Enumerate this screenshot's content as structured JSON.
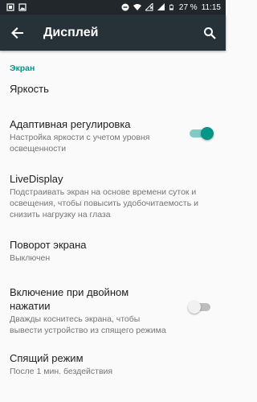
{
  "status_bar": {
    "battery": "27 %",
    "time": "11:15",
    "icons": [
      "notification-box-icon",
      "image-icon",
      "do-not-disturb-icon",
      "wifi-icon",
      "signal-no-sim-icon",
      "signal-icon",
      "battery-icon"
    ]
  },
  "toolbar": {
    "title": "Дисплей",
    "back_icon": "arrow-back-icon",
    "search_icon": "search-icon"
  },
  "colors": {
    "accent": "#009688",
    "toolbar": "#263238",
    "status_bar": "#21272b"
  },
  "section": {
    "header": "Экран"
  },
  "items": [
    {
      "title": "Яркость",
      "summary": ""
    },
    {
      "title": "Адаптивная регулировка",
      "summary": "Настройка яркости с учетом уровня освещенности",
      "switch": "on"
    },
    {
      "title": "LiveDisplay",
      "summary": "Подстраивать экран на основе времени суток и освещения, чтобы повысить удобочитаемость и снизить нагрузку на глаза"
    },
    {
      "title": "Поворот экрана",
      "summary": "Выключен"
    },
    {
      "title": "Включение при двойном нажатии",
      "summary": "Дважды коснитесь экрана, чтобы вывести устройство из спящего режима",
      "switch": "off"
    },
    {
      "title": "Спящий режим",
      "summary": "После 1 мин. бездействия"
    }
  ]
}
